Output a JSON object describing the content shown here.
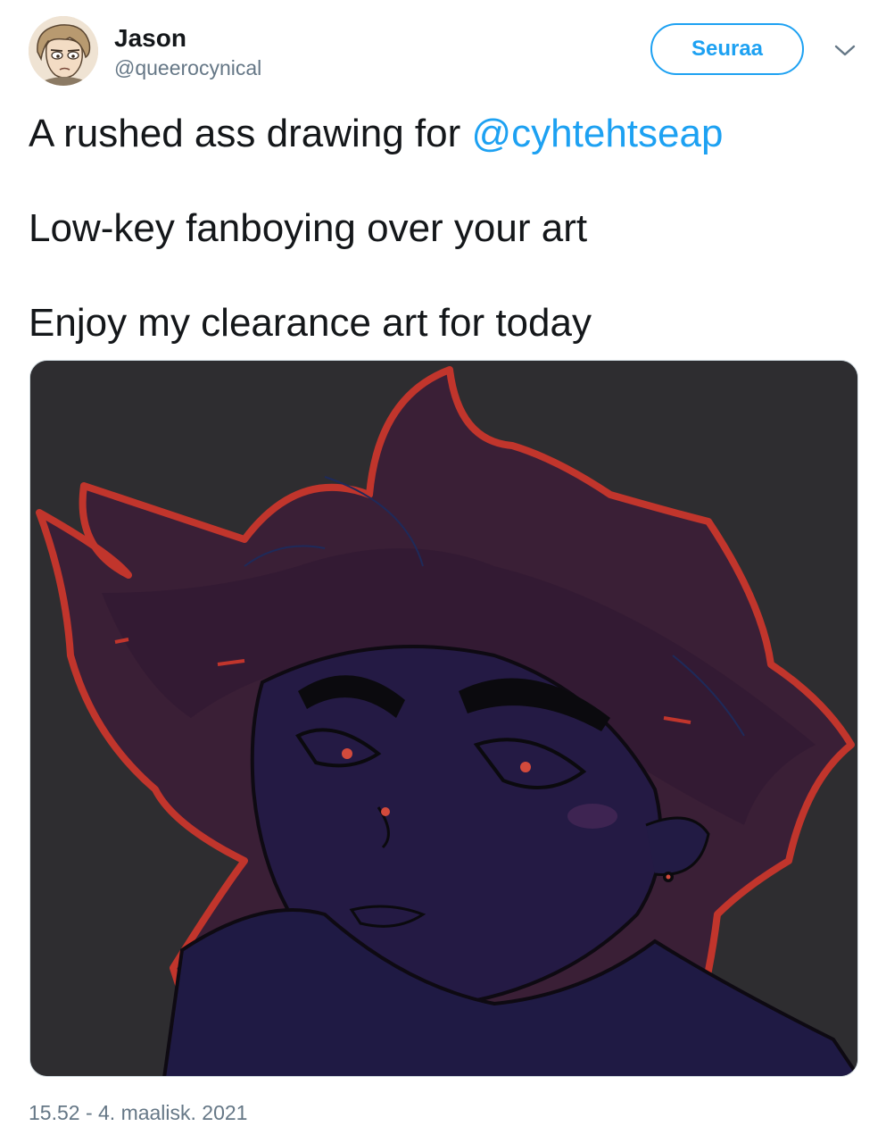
{
  "author": {
    "display_name": "Jason",
    "handle": "@queerocynical"
  },
  "follow_button": {
    "label": "Seuraa"
  },
  "tweet": {
    "line1_prefix": "A rushed ass drawing for ",
    "line1_mention": "@cyhtehtseap",
    "line2": "Low-key fanboying over your art",
    "line3": "Enjoy my clearance art for today"
  },
  "timestamp": "15.52 - 4. maalisk. 2021",
  "icons": {
    "avatar": "avatar-illustration",
    "menu": "chevron-down-icon"
  },
  "colors": {
    "accent": "#1da1f2",
    "secondary_text": "#657786",
    "primary_text": "#14171a"
  }
}
